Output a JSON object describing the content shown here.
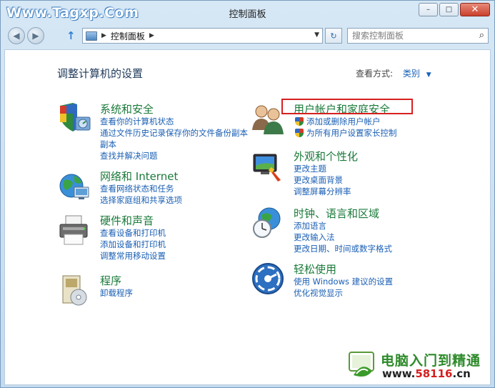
{
  "watermark": "Www.Tagxp.Com",
  "window": {
    "title": "控制面板",
    "minimize": "–",
    "maximize": "□",
    "close": "✕"
  },
  "address": {
    "path": "控制面板",
    "search_placeholder": "搜索控制面板"
  },
  "content": {
    "heading": "调整计算机的设置",
    "view_by_label": "查看方式:",
    "view_by_value": "类别"
  },
  "groups": {
    "system": {
      "title": "系统和安全",
      "links": [
        "查看你的计算机状态",
        "通过文件历史记录保存你的文件备份副本",
        "副本",
        "查找并解决问题"
      ]
    },
    "network": {
      "title": "网络和 Internet",
      "links": [
        "查看网络状态和任务",
        "选择家庭组和共享选项"
      ]
    },
    "hardware": {
      "title": "硬件和声音",
      "links": [
        "查看设备和打印机",
        "添加设备和打印机",
        "调整常用移动设置"
      ]
    },
    "programs": {
      "title": "程序",
      "links": [
        "卸载程序"
      ]
    },
    "users": {
      "title": "用户帐户和家庭安全",
      "links": [
        "添加或删除用户帐户",
        "为所有用户设置家长控制"
      ]
    },
    "appearance": {
      "title": "外观和个性化",
      "links": [
        "更改主题",
        "更改桌面背景",
        "调整屏幕分辨率"
      ]
    },
    "clock": {
      "title": "时钟、语言和区域",
      "links": [
        "添加语言",
        "更改输入法",
        "更改日期、时间或数字格式"
      ]
    },
    "ease": {
      "title": "轻松使用",
      "links": [
        "使用 Windows 建议的设置",
        "优化视觉显示"
      ]
    }
  },
  "brand": {
    "name": "电脑入门到精通",
    "url_prefix": "www.",
    "url_number": "58116",
    "url_suffix": ".cn"
  },
  "colors": {
    "group_title": "#1a7a3a",
    "link": "#1a5fb4",
    "highlight": "#d61f1f"
  }
}
